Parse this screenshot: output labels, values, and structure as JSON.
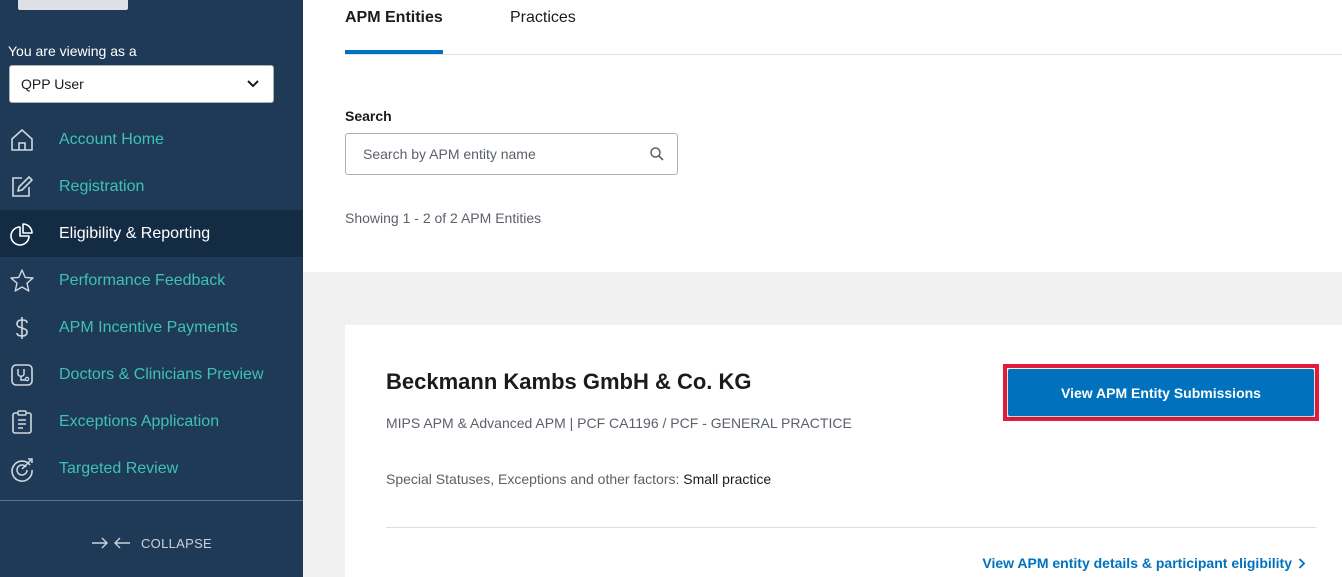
{
  "sidebar": {
    "viewing_label": "You are viewing as a",
    "role_select": {
      "value": "QPP User"
    },
    "items": [
      {
        "label": "Account Home",
        "icon": "home-icon",
        "active": false
      },
      {
        "label": "Registration",
        "icon": "edit-icon",
        "active": false
      },
      {
        "label": "Eligibility & Reporting",
        "icon": "pie-chart-icon",
        "active": true
      },
      {
        "label": "Performance Feedback",
        "icon": "star-icon",
        "active": false
      },
      {
        "label": "APM Incentive Payments",
        "icon": "dollar-icon",
        "active": false
      },
      {
        "label": "Doctors & Clinicians Preview",
        "icon": "stethoscope-icon",
        "active": false
      },
      {
        "label": "Exceptions Application",
        "icon": "clipboard-icon",
        "active": false
      },
      {
        "label": "Targeted Review",
        "icon": "target-review-icon",
        "active": false
      }
    ],
    "collapse_label": "COLLAPSE"
  },
  "tabs": [
    {
      "label": "APM Entities",
      "active": true
    },
    {
      "label": "Practices",
      "active": false
    }
  ],
  "search": {
    "label": "Search",
    "placeholder": "Search by APM entity name",
    "value": ""
  },
  "results": {
    "showing": "Showing 1 - 2 of 2 APM Entities"
  },
  "entity": {
    "name": "Beckmann Kambs GmbH & Co. KG",
    "subtitle": "MIPS APM & Advanced APM | PCF CA1196 / PCF - GENERAL PRACTICE",
    "status_label": "Special Statuses, Exceptions and other factors: ",
    "status_value": "Small practice",
    "view_button": "View APM Entity Submissions",
    "details_link": "View APM entity details & participant eligibility"
  },
  "colors": {
    "sidebar_bg": "#1f3a56",
    "sidebar_active_bg": "#132b43",
    "nav_teal": "#3fc1b5",
    "primary_blue": "#0071bc",
    "highlight_red": "#e31c3d"
  }
}
